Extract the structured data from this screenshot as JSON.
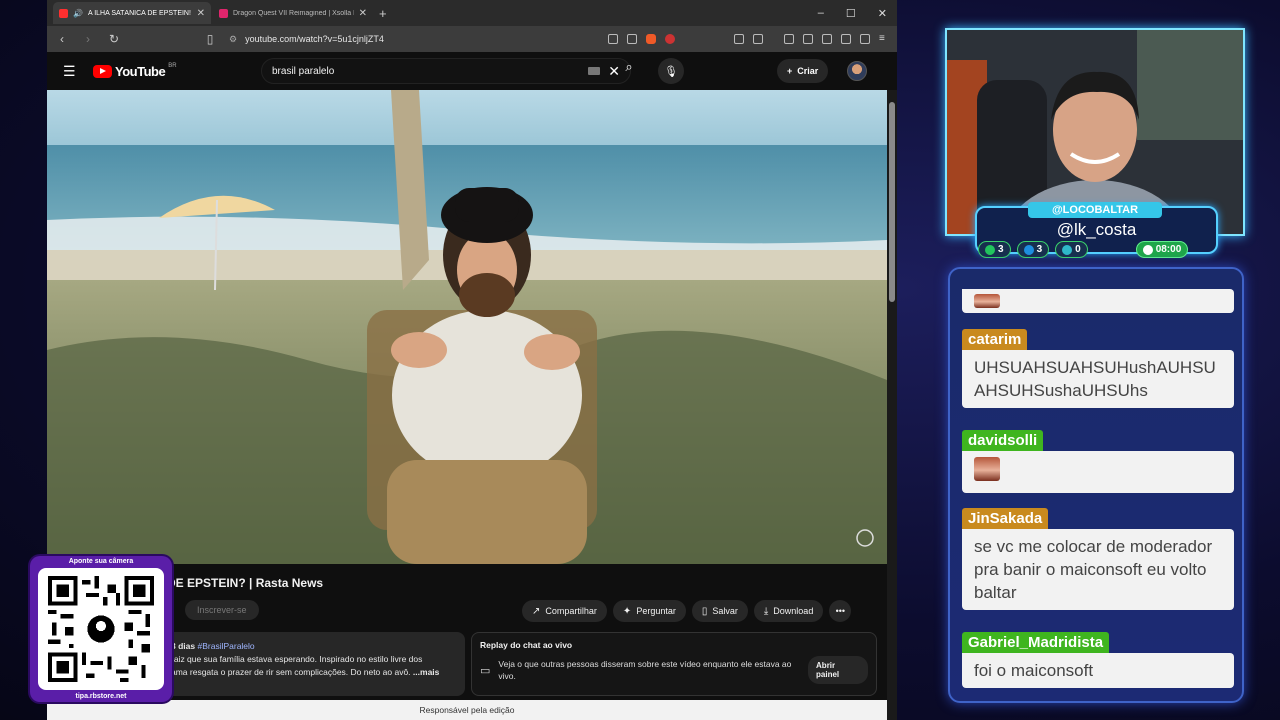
{
  "browser": {
    "tabs": [
      {
        "title": "A ILHA SATÂNICA DE EPSTEIN! | Ra",
        "active": true,
        "color": "#ff2f2f"
      },
      {
        "title": "Dragon Quest VII Reimagined | Xsolla Partne",
        "active": false,
        "color": "#e0256c"
      }
    ],
    "new_tab": "+",
    "window_controls": [
      "–",
      "☐",
      "✕"
    ],
    "url": "youtube.com/watch?v=5u1cjnljZT4"
  },
  "youtube": {
    "logo_text": "YouTube",
    "region": "BR",
    "search_value": "brasil paralelo",
    "create_label": "Criar",
    "video_title": "DE EPSTEIN? | Rasta News",
    "subscribe_label": "Inscrever-se",
    "actions": [
      "Compartilhar",
      "Perguntar",
      "Salvar",
      "Download"
    ],
    "description": {
      "meta": "3 dias",
      "hashtag": "#BrasilParalelo",
      "line1": "raiz que sua família estava esperando. Inspirado no estilo livre dos",
      "line2": "ama resgata o prazer de rir sem complicações. Do neto ao avô.",
      "more": "...mais"
    },
    "replay": {
      "title": "Replay do chat ao vivo",
      "text": "Veja o que outras pessoas disseram sobre este vídeo enquanto ele estava ao vivo.",
      "button": "Abrir painel"
    },
    "bottom_bar": "Responsável pela edição"
  },
  "qr": {
    "top_label": "Aponte sua câmera",
    "bottom_label": "tipa.rbstore.net"
  },
  "stream": {
    "channel_tag": "@LOCOBALTAR",
    "handle": "@lk_costa",
    "stats": [
      "3",
      "3",
      "0"
    ],
    "time": "08:00"
  },
  "chat": [
    {
      "name": "catarim",
      "text": "UHSUAHSUAHSUHushAUHSUAHSUHSushaUHSUhs",
      "name_color": "#c98a1e"
    },
    {
      "name": "davidsolli",
      "text": "",
      "emote": true,
      "name_color": "#3fb51f"
    },
    {
      "name": "JinSakada",
      "text": "se vc me colocar de moderador pra banir o maiconsoft eu volto baltar",
      "name_color": "#c98a1e"
    },
    {
      "name": "Gabriel_Madridista",
      "text": "foi o maiconsoft",
      "name_color": "#3fb51f"
    }
  ]
}
